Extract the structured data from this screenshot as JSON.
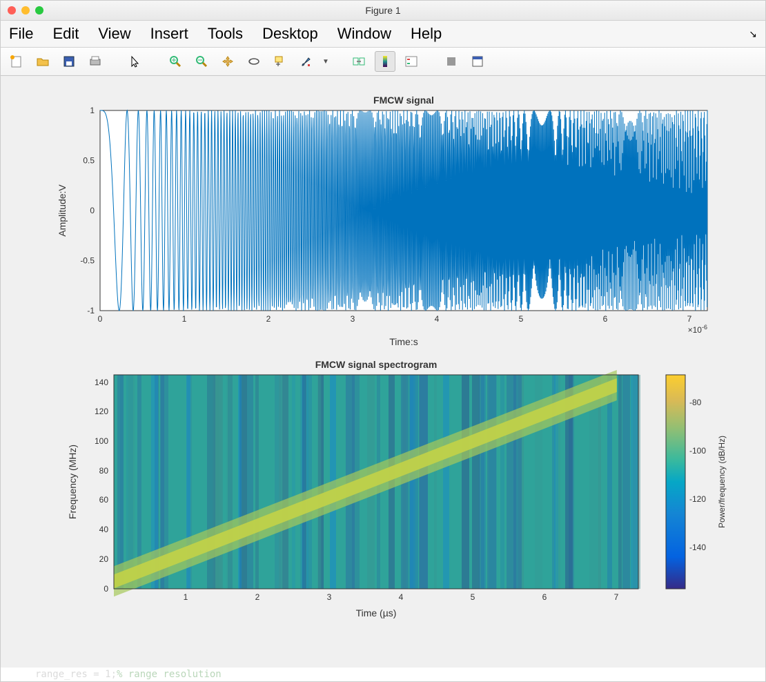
{
  "window": {
    "title": "Figure 1"
  },
  "menus": [
    "File",
    "Edit",
    "View",
    "Insert",
    "Tools",
    "Desktop",
    "Window",
    "Help"
  ],
  "toolbar_icons": [
    "new",
    "open",
    "save",
    "print",
    "pointer",
    "zoom-in",
    "zoom-out",
    "pan",
    "rotate3d",
    "datacursor",
    "brush",
    "linkaxes",
    "colorbar",
    "legend",
    "hide",
    "dock"
  ],
  "chart_data": [
    {
      "type": "line",
      "title": "FMCW signal",
      "xlabel": "Time:s",
      "ylabel": "Amplitude:V",
      "xlim": [
        0,
        7.2e-06
      ],
      "ylim": [
        -1,
        1
      ],
      "xticks": [
        0,
        1,
        2,
        3,
        4,
        5,
        6,
        7
      ],
      "xtick_scale_label": "×10^{-6}",
      "yticks": [
        -1,
        -0.5,
        0,
        0.5,
        1
      ],
      "description": "Linear chirp (FMCW up-sweep) time-domain waveform, amplitude ±1, sweep from ~0 Hz to ~140 MHz over 7.2 µs.",
      "series": [
        {
          "name": "FMCW chirp (real part)",
          "formula": "cos(2*pi*(0.5*k*t^2)), k=bw/T, bw=140e6, T=7.2e-6, t in [0,T]",
          "color": "#0072BD"
        }
      ]
    },
    {
      "type": "heatmap",
      "title": "FMCW signal spectrogram",
      "xlabel": "Time (µs)",
      "ylabel": "Frequency (MHz)",
      "xlim": [
        0,
        7.3
      ],
      "ylim": [
        0,
        145
      ],
      "xticks": [
        1,
        2,
        3,
        4,
        5,
        6,
        7
      ],
      "yticks": [
        0,
        20,
        40,
        60,
        80,
        100,
        120,
        140
      ],
      "colorbar": {
        "label": "Power/frequency (dB/Hz)",
        "ticks": [
          -80,
          -100,
          -120,
          -140
        ],
        "range": [
          -160,
          -70
        ],
        "colormap": "parula"
      },
      "description": "Spectrogram showing a single bright diagonal ridge (linear frequency sweep) from ~5 MHz at t≈0 to ~140 MHz at t≈7.3 µs, background ≈ -120 to -140 dB/Hz, ridge ≈ -80 dB/Hz.",
      "ridge_points": [
        {
          "t_us": 0.0,
          "f_mhz": 5
        },
        {
          "t_us": 1.0,
          "f_mhz": 24
        },
        {
          "t_us": 2.0,
          "f_mhz": 43
        },
        {
          "t_us": 3.0,
          "f_mhz": 62
        },
        {
          "t_us": 4.0,
          "f_mhz": 81
        },
        {
          "t_us": 5.0,
          "f_mhz": 100
        },
        {
          "t_us": 6.0,
          "f_mhz": 119
        },
        {
          "t_us": 7.0,
          "f_mhz": 138
        }
      ]
    }
  ],
  "footer_code": "range_res = 1;% range resolution"
}
